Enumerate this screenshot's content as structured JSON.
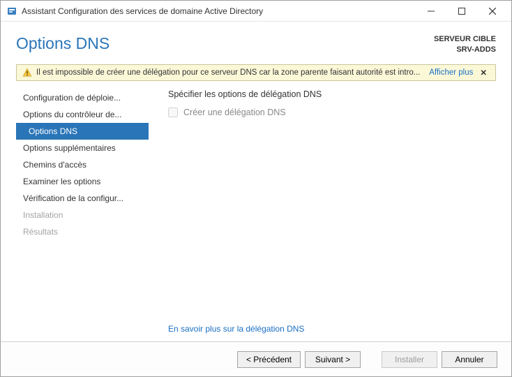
{
  "window": {
    "title": "Assistant Configuration des services de domaine Active Directory"
  },
  "header": {
    "title": "Options DNS",
    "target_label": "SERVEUR CIBLE",
    "target_server": "SRV-ADDS"
  },
  "warning": {
    "text": "Il est impossible de créer une délégation pour ce serveur DNS car la zone parente faisant autorité est intro...",
    "more_label": "Afficher plus"
  },
  "sidebar": {
    "items": [
      {
        "label": "Configuration de déploie...",
        "active": false,
        "disabled": false
      },
      {
        "label": "Options du contrôleur de...",
        "active": false,
        "disabled": false
      },
      {
        "label": "Options DNS",
        "active": true,
        "disabled": false
      },
      {
        "label": "Options supplémentaires",
        "active": false,
        "disabled": false
      },
      {
        "label": "Chemins d'accès",
        "active": false,
        "disabled": false
      },
      {
        "label": "Examiner les options",
        "active": false,
        "disabled": false
      },
      {
        "label": "Vérification de la configur...",
        "active": false,
        "disabled": false
      },
      {
        "label": "Installation",
        "active": false,
        "disabled": true
      },
      {
        "label": "Résultats",
        "active": false,
        "disabled": true
      }
    ]
  },
  "content": {
    "section_title": "Spécifier les options de délégation DNS",
    "checkbox_label": "Créer une délégation DNS",
    "learn_more_label": "En savoir plus sur la délégation DNS"
  },
  "footer": {
    "prev": "< Précédent",
    "next": "Suivant >",
    "install": "Installer",
    "cancel": "Annuler"
  }
}
